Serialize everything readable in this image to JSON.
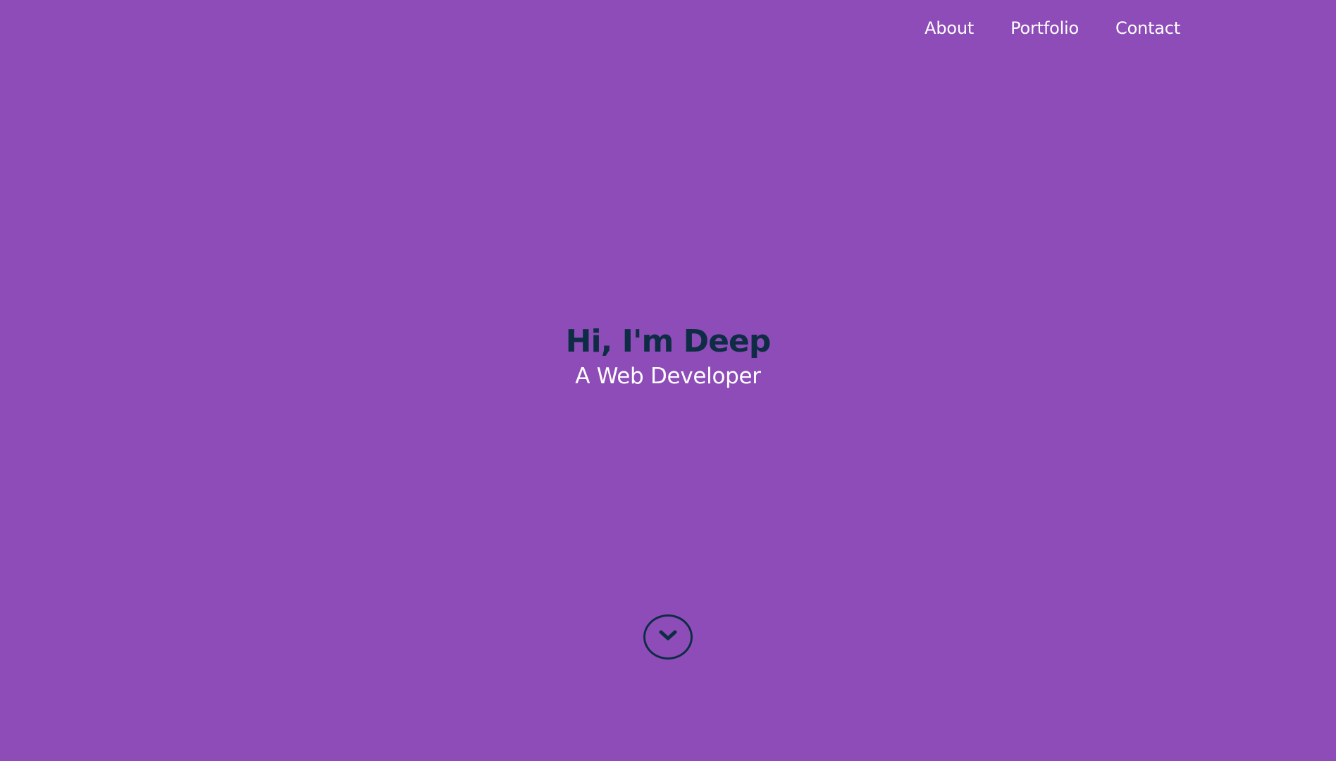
{
  "nav": {
    "items": [
      {
        "label": "About"
      },
      {
        "label": "Portfolio"
      },
      {
        "label": "Contact"
      }
    ]
  },
  "hero": {
    "title": "Hi, I'm Deep",
    "subtitle": "A Web Developer"
  },
  "scroll_down": {
    "icon": "chevron-down-icon"
  },
  "colors": {
    "background": "#8e4cb9",
    "title": "#0e2d44",
    "text": "#ffffff",
    "icon": "#0e2d44"
  }
}
